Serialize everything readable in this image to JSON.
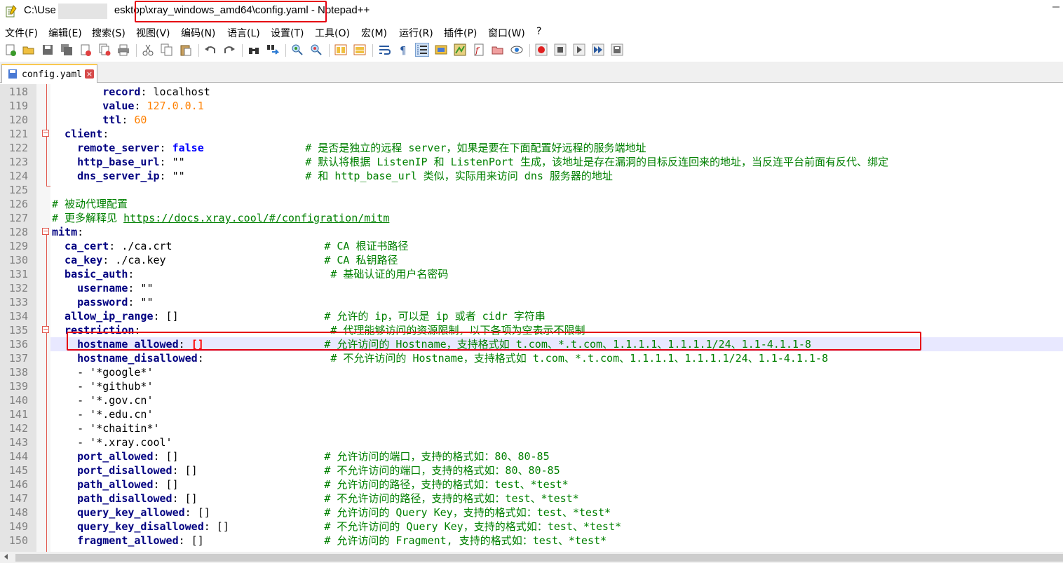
{
  "window": {
    "title_prefix": "C:\\Use",
    "title_mid": "esktop",
    "title_path": "\\xray_windows_amd64\\config.yaml",
    "title_suffix": " - Notepad++"
  },
  "menu": [
    "文件(F)",
    "编辑(E)",
    "搜索(S)",
    "视图(V)",
    "编码(N)",
    "语言(L)",
    "设置(T)",
    "工具(O)",
    "宏(M)",
    "运行(R)",
    "插件(P)",
    "窗口(W)",
    "?"
  ],
  "toolbar_icons": [
    "new-file-icon",
    "open-file-icon",
    "save-icon",
    "save-all-icon",
    "close-icon",
    "close-all-icon",
    "print-icon",
    "cut-icon",
    "copy-icon",
    "paste-icon",
    "undo-icon",
    "redo-icon",
    "find-icon",
    "replace-icon",
    "zoom-in-icon",
    "zoom-out-icon",
    "sync-vertical-icon",
    "sync-horizontal-icon",
    "word-wrap-icon",
    "show-all-chars-icon",
    "indent-guide-icon",
    "udl-icon",
    "doc-map-icon",
    "function-list-icon",
    "folder-workspace-icon",
    "monitor-icon",
    "record-macro-icon",
    "stop-macro-icon",
    "play-macro-icon",
    "run-macro-multiple-icon",
    "save-macro-icon"
  ],
  "tab": {
    "label": "config.yaml",
    "close": "×"
  },
  "lines": [
    {
      "n": "118",
      "t": [
        [
          "k",
          "        record"
        ],
        [
          "p",
          ": localhost"
        ]
      ]
    },
    {
      "n": "119",
      "t": [
        [
          "k",
          "        value"
        ],
        [
          "p",
          ": "
        ],
        [
          "n",
          "127.0.0.1"
        ]
      ]
    },
    {
      "n": "120",
      "t": [
        [
          "k",
          "        ttl"
        ],
        [
          "p",
          ": "
        ],
        [
          "n",
          "60"
        ]
      ]
    },
    {
      "n": "121",
      "t": [
        [
          "k",
          "  client"
        ],
        [
          "p",
          ":"
        ]
      ]
    },
    {
      "n": "122",
      "t": [
        [
          "k",
          "    remote_server"
        ],
        [
          "p",
          ": "
        ],
        [
          "b",
          "false"
        ],
        [
          "p",
          "                "
        ],
        [
          "c",
          "# 是否是独立的远程 server，如果是要在下面配置好远程的服务端地址"
        ]
      ]
    },
    {
      "n": "123",
      "t": [
        [
          "k",
          "    http_base_url"
        ],
        [
          "p",
          ": \"\"                   "
        ],
        [
          "c",
          "# 默认将根据 ListenIP 和 ListenPort 生成，该地址是存在漏洞的目标反连回来的地址，当反连平台前面有反代、绑定"
        ]
      ]
    },
    {
      "n": "124",
      "t": [
        [
          "k",
          "    dns_server_ip"
        ],
        [
          "p",
          ": \"\"                   "
        ],
        [
          "c",
          "# 和 http_base_url 类似，实际用来访问 dns 服务器的地址"
        ]
      ]
    },
    {
      "n": "125",
      "t": [
        [
          "p",
          ""
        ]
      ]
    },
    {
      "n": "126",
      "t": [
        [
          "c",
          "# 被动代理配置"
        ]
      ]
    },
    {
      "n": "127",
      "t": [
        [
          "c",
          "# 更多解释见 "
        ],
        [
          "u",
          "https://docs.xray.cool/#/configration/mitm"
        ]
      ]
    },
    {
      "n": "128",
      "t": [
        [
          "k",
          "mitm"
        ],
        [
          "p",
          ":"
        ]
      ]
    },
    {
      "n": "129",
      "t": [
        [
          "k",
          "  ca_cert"
        ],
        [
          "p",
          ": ./ca.crt                        "
        ],
        [
          "c",
          "# CA 根证书路径"
        ]
      ]
    },
    {
      "n": "130",
      "t": [
        [
          "k",
          "  ca_key"
        ],
        [
          "p",
          ": ./ca.key                         "
        ],
        [
          "c",
          "# CA 私钥路径"
        ]
      ]
    },
    {
      "n": "131",
      "t": [
        [
          "k",
          "  basic_auth"
        ],
        [
          "p",
          ":                               "
        ],
        [
          "c",
          "# 基础认证的用户名密码"
        ]
      ]
    },
    {
      "n": "132",
      "t": [
        [
          "k",
          "    username"
        ],
        [
          "p",
          ": \"\""
        ]
      ]
    },
    {
      "n": "133",
      "t": [
        [
          "k",
          "    password"
        ],
        [
          "p",
          ": \"\""
        ]
      ]
    },
    {
      "n": "134",
      "t": [
        [
          "k",
          "  allow_ip_range"
        ],
        [
          "p",
          ": []                       "
        ],
        [
          "c",
          "# 允许的 ip，可以是 ip 或者 cidr 字符串"
        ]
      ]
    },
    {
      "n": "135",
      "t": [
        [
          "k",
          "  restriction"
        ],
        [
          "p",
          ":                              "
        ],
        [
          "c",
          "# 代理能够访问的资源限制，以下各项为空表示不限制"
        ]
      ]
    },
    {
      "n": "136",
      "t": [
        [
          "k",
          "    hostname_allowed"
        ],
        [
          "p",
          ": "
        ],
        [
          "br",
          "[]"
        ],
        [
          "p",
          "                   "
        ],
        [
          "c",
          "# 允许访问的 Hostname，支持格式如 t.com、*.t.com、1.1.1.1、1.1.1.1/24、1.1-4.1.1-8"
        ]
      ]
    },
    {
      "n": "137",
      "t": [
        [
          "k",
          "    hostname_disallowed"
        ],
        [
          "p",
          ":                    "
        ],
        [
          "c",
          "# 不允许访问的 Hostname，支持格式如 t.com、*.t.com、1.1.1.1、1.1.1.1/24、1.1-4.1.1-8"
        ]
      ]
    },
    {
      "n": "138",
      "t": [
        [
          "p",
          "    - '*google*'"
        ]
      ]
    },
    {
      "n": "139",
      "t": [
        [
          "p",
          "    - '*github*'"
        ]
      ]
    },
    {
      "n": "140",
      "t": [
        [
          "p",
          "    - '*.gov.cn'"
        ]
      ]
    },
    {
      "n": "141",
      "t": [
        [
          "p",
          "    - '*.edu.cn'"
        ]
      ]
    },
    {
      "n": "142",
      "t": [
        [
          "p",
          "    - '*chaitin*'"
        ]
      ]
    },
    {
      "n": "143",
      "t": [
        [
          "p",
          "    - '*.xray.cool'"
        ]
      ]
    },
    {
      "n": "144",
      "t": [
        [
          "k",
          "    port_allowed"
        ],
        [
          "p",
          ": []                       "
        ],
        [
          "c",
          "# 允许访问的端口，支持的格式如：80、80-85"
        ]
      ]
    },
    {
      "n": "145",
      "t": [
        [
          "k",
          "    port_disallowed"
        ],
        [
          "p",
          ": []                    "
        ],
        [
          "c",
          "# 不允许访问的端口，支持的格式如：80、80-85"
        ]
      ]
    },
    {
      "n": "146",
      "t": [
        [
          "k",
          "    path_allowed"
        ],
        [
          "p",
          ": []                       "
        ],
        [
          "c",
          "# 允许访问的路径，支持的格式如：test、*test*"
        ]
      ]
    },
    {
      "n": "147",
      "t": [
        [
          "k",
          "    path_disallowed"
        ],
        [
          "p",
          ": []                    "
        ],
        [
          "c",
          "# 不允许访问的路径，支持的格式如：test、*test*"
        ]
      ]
    },
    {
      "n": "148",
      "t": [
        [
          "k",
          "    query_key_allowed"
        ],
        [
          "p",
          ": []                  "
        ],
        [
          "c",
          "# 允许访问的 Query Key，支持的格式如：test、*test*"
        ]
      ]
    },
    {
      "n": "149",
      "t": [
        [
          "k",
          "    query_key_disallowed"
        ],
        [
          "p",
          ": []               "
        ],
        [
          "c",
          "# 不允许访问的 Query Key，支持的格式如：test、*test*"
        ]
      ]
    },
    {
      "n": "150",
      "t": [
        [
          "k",
          "    fragment_allowed"
        ],
        [
          "p",
          ": []                   "
        ],
        [
          "c",
          "# 允许访问的 Fragment, 支持的格式如：test、*test*"
        ]
      ]
    }
  ]
}
